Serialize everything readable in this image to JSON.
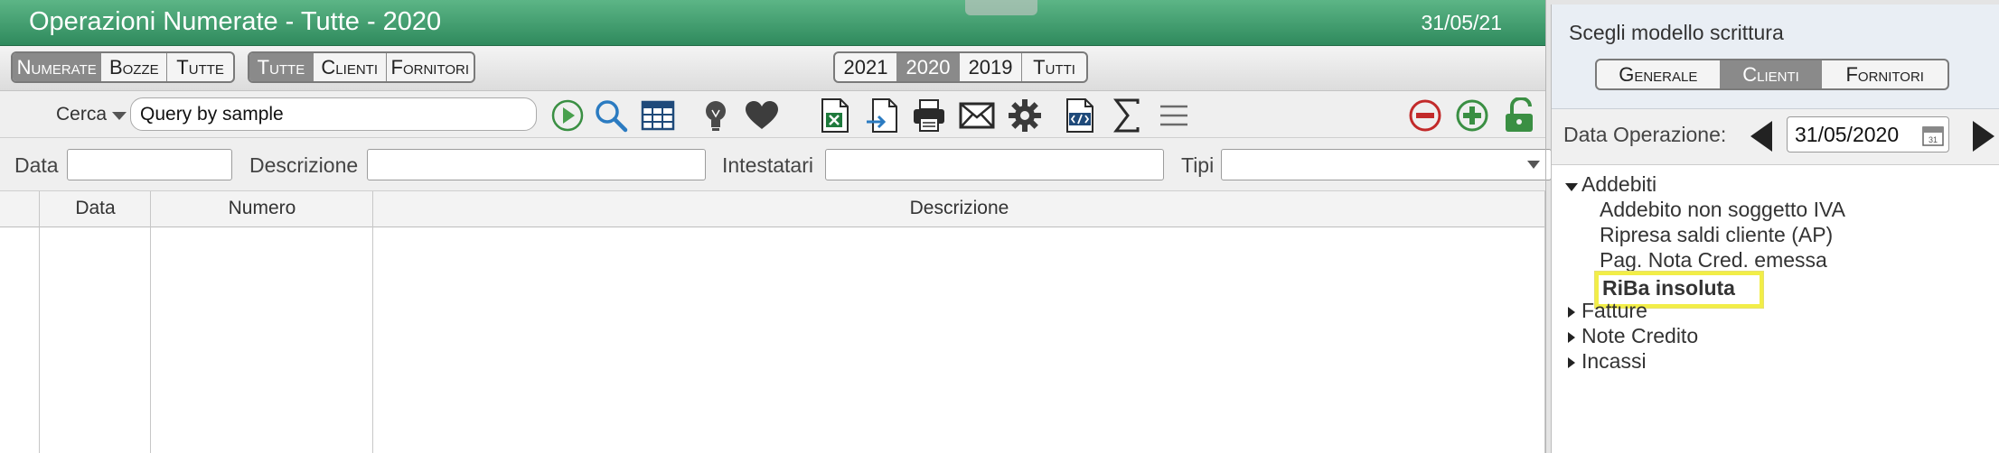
{
  "window": {
    "title": "Operazioni Numerate - Tutte - 2020",
    "date": "31/05/21"
  },
  "tabs": {
    "group1": [
      "Numerate",
      "Bozze",
      "Tutte"
    ],
    "group1_active": "Numerate",
    "group2": [
      "Tutte",
      "Clienti",
      "Fornitori"
    ],
    "group2_active": "Tutte",
    "years": [
      "2021",
      "2020",
      "2019",
      "Tutti"
    ],
    "years_active": "2020"
  },
  "toolbar": {
    "search_label": "Cerca",
    "search_value": "Query by sample",
    "icons": [
      "play-icon",
      "search-icon",
      "table-icon",
      "lightbulb-icon",
      "heart-icon",
      "excel-icon",
      "import-icon",
      "print-icon",
      "mail-icon",
      "gear-icon",
      "code-file-icon",
      "sigma-icon",
      "menu-icon",
      "remove-icon",
      "add-icon",
      "unlock-icon"
    ]
  },
  "filters": {
    "data_label": "Data",
    "descrizione_label": "Descrizione",
    "intestatari_label": "Intestatari",
    "tipi_label": "Tipi"
  },
  "grid": {
    "columns": [
      "Data",
      "Numero",
      "Descrizione"
    ]
  },
  "panel": {
    "title": "Scegli modello scrittura",
    "tabs": [
      "Generale",
      "Clienti",
      "Fornitori"
    ],
    "tabs_active": "Clienti",
    "date_label": "Data Operazione:",
    "date_value": "31/05/2020",
    "tree": {
      "addebiti": "Addebiti",
      "addebiti_children": [
        "Addebito non soggetto IVA",
        "Ripresa saldi cliente (AP)",
        "Pag. Nota Cred. emessa",
        "RiBa insoluta"
      ],
      "selected": "RiBa insoluta",
      "fatture": "Fatture",
      "note_credito": "Note Credito",
      "incassi": "Incassi"
    }
  },
  "colors": {
    "title_green": "#3c9a6a",
    "highlight_yellow": "#f2ee47",
    "segment_active": "#8a8a8a"
  }
}
